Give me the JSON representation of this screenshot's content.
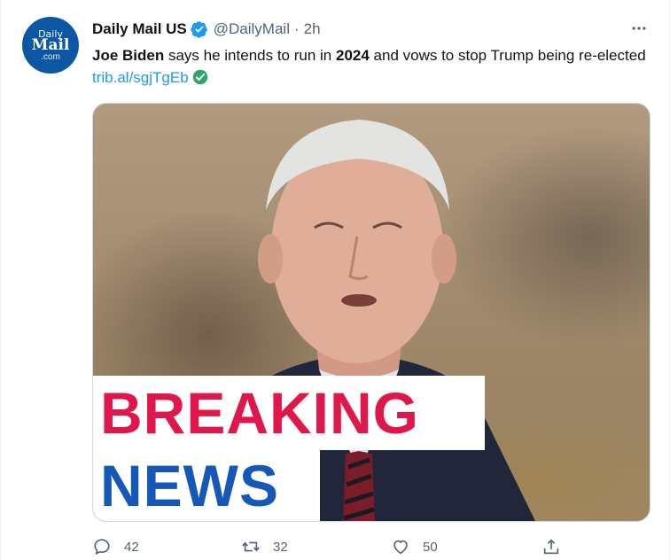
{
  "author": {
    "avatar_line1": "Daily",
    "avatar_line2": "Mail",
    "avatar_line3": ".com",
    "name": "Daily Mail US",
    "handle": "@DailyMail",
    "separator": "·",
    "time": "2h"
  },
  "tweet": {
    "bold1": "Joe Biden",
    "text1": " says he intends to run in ",
    "bold2": "2024",
    "text2": " and vows to stop Trump being re-elected ",
    "link": "trib.al/sgjTgEb"
  },
  "media": {
    "banner_line1": "BREAKING",
    "banner_line2": "NEWS"
  },
  "actions": {
    "reply_count": "42",
    "retweet_count": "32",
    "like_count": "50"
  },
  "colors": {
    "link": "#1d9bf0",
    "verified": "#1d9bf0",
    "breaking_red": "#e0174a",
    "news_blue": "#1658b7"
  },
  "icons": [
    "verified-badge-icon",
    "more-icon",
    "check-icon",
    "reply-icon",
    "retweet-icon",
    "like-icon",
    "share-icon"
  ]
}
